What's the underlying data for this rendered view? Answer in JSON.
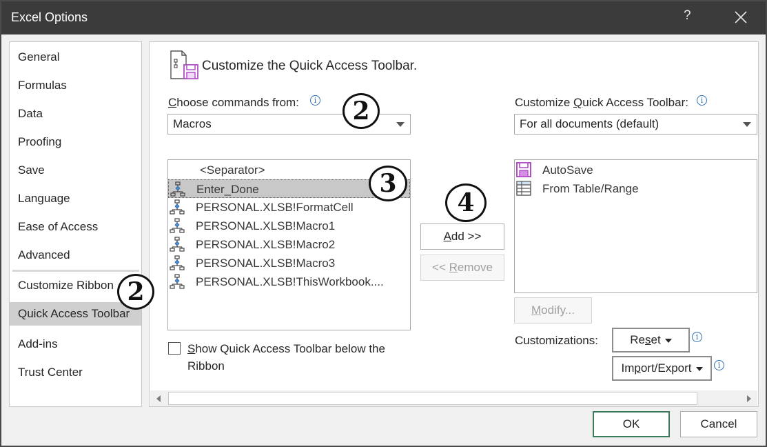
{
  "window": {
    "title": "Excel Options",
    "help": "?",
    "close_icon": "close-icon"
  },
  "nav": {
    "items": [
      {
        "label": "General"
      },
      {
        "label": "Formulas"
      },
      {
        "label": "Data"
      },
      {
        "label": "Proofing"
      },
      {
        "label": "Save"
      },
      {
        "label": "Language"
      },
      {
        "label": "Ease of Access"
      },
      {
        "label": "Advanced"
      },
      {
        "label": "Customize Ribbon"
      },
      {
        "label": "Quick Access Toolbar",
        "selected": true
      },
      {
        "label": "Add-ins"
      },
      {
        "label": "Trust Center"
      }
    ]
  },
  "main": {
    "heading": "Customize the Quick Access Toolbar.",
    "choose": {
      "label_prefix": "",
      "label_accel": "C",
      "label_rest": "hoose commands from:",
      "value": "Macros"
    },
    "commands": {
      "items": [
        {
          "label": "<Separator>",
          "type": "separator"
        },
        {
          "label": "Enter_Done",
          "icon": "macro-icon",
          "selected": true
        },
        {
          "label": "PERSONAL.XLSB!FormatCell",
          "icon": "macro-icon"
        },
        {
          "label": "PERSONAL.XLSB!Macro1",
          "icon": "macro-icon"
        },
        {
          "label": "PERSONAL.XLSB!Macro2",
          "icon": "macro-icon"
        },
        {
          "label": "PERSONAL.XLSB!Macro3",
          "icon": "macro-icon"
        },
        {
          "label": "PERSONAL.XLSB!ThisWorkbook....",
          "icon": "macro-icon"
        }
      ]
    },
    "add_button": {
      "accel": "A",
      "rest": "dd >>"
    },
    "remove_button": {
      "prefix": "<< ",
      "accel": "R",
      "rest": "emove"
    },
    "checkbox": {
      "accel": "S",
      "line1_rest": "how Quick Access Toolbar below the",
      "line2": "Ribbon",
      "checked": false
    },
    "customize": {
      "label_prefix": "Customize ",
      "label_accel": "Q",
      "label_rest": "uick Access Toolbar:",
      "value": "For all documents (default)"
    },
    "toolbar_items": [
      {
        "label": "AutoSave",
        "icon": "save-icon"
      },
      {
        "label": "From Table/Range",
        "icon": "table-icon"
      }
    ],
    "modify_button": {
      "accel": "M",
      "rest": "odify..."
    },
    "customizations_label": "Customizations:",
    "reset_button": {
      "prefix": "Re",
      "accel": "s",
      "rest": "et"
    },
    "import_export_button": {
      "prefix": "Im",
      "accel": "p",
      "rest": "ort/Export"
    }
  },
  "footer": {
    "ok": "OK",
    "cancel": "Cancel"
  },
  "callouts": {
    "choose": "2",
    "nav": "2",
    "list": "3",
    "add": "4"
  },
  "colors": {
    "titlebar": "#3b3b3b",
    "selection": "#c8c8c8",
    "accent_purple": "#b14fc5",
    "info_blue": "#2f6fb5",
    "ok_border": "#3c7a5c"
  }
}
